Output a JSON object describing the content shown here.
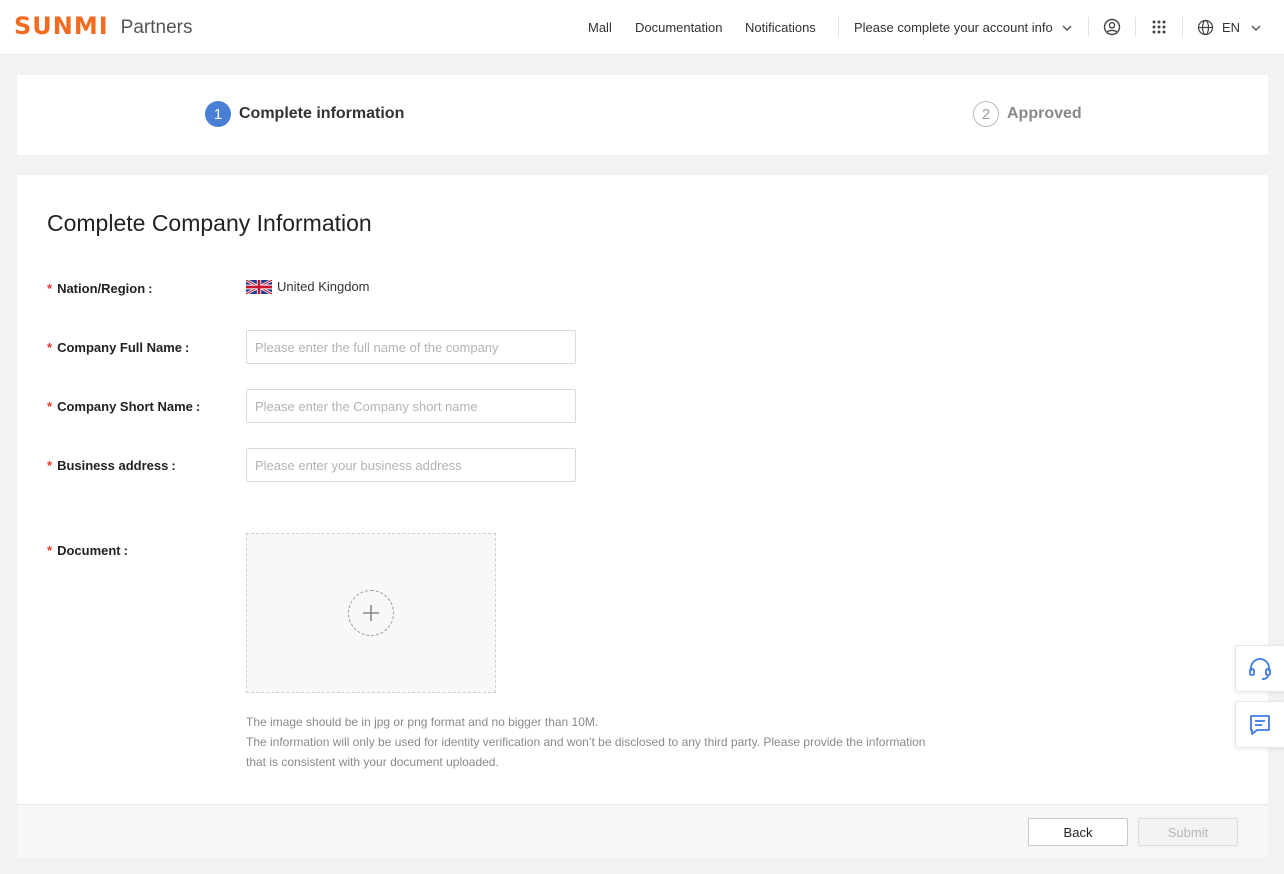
{
  "header": {
    "logo_mark": "SUNMI",
    "logo_text": "Partners",
    "nav": {
      "mall": "Mall",
      "documentation": "Documentation",
      "notifications": "Notifications"
    },
    "account_label": "Please complete your account info",
    "language": "EN",
    "icons": [
      "user-circle-icon",
      "apps-grid-icon",
      "globe-icon",
      "chevron-down-icon"
    ]
  },
  "steps": [
    {
      "number": "1",
      "label": "Complete information",
      "state": "active"
    },
    {
      "number": "2",
      "label": "Approved",
      "state": "pending"
    }
  ],
  "form": {
    "title": "Complete Company Information",
    "required_mark": "*",
    "fields": {
      "nation": {
        "label": "Nation/Region",
        "value": "United Kingdom"
      },
      "full_name": {
        "label": "Company Full Name",
        "value": "",
        "placeholder": "Please enter the full name of the company"
      },
      "short_name": {
        "label": "Company Short Name",
        "value": "",
        "placeholder": "Please enter the Company short name"
      },
      "address": {
        "label": "Business address",
        "value": "",
        "placeholder": "Please enter your business address"
      },
      "document": {
        "label": "Document"
      }
    },
    "hints": {
      "line1": "The image should be in jpg or png format and no bigger than 10M.",
      "line2": "The information will only be used for identity verification and won’t be disclosed to any third party. Please provide the information that is consistent with your document uploaded."
    }
  },
  "footer": {
    "back_label": "Back",
    "submit_label": "Submit"
  },
  "colors": {
    "brand": "#f26b21",
    "accent": "#4a7fd6",
    "required": "#e8392b"
  },
  "floating": [
    "headset-icon",
    "message-icon"
  ]
}
